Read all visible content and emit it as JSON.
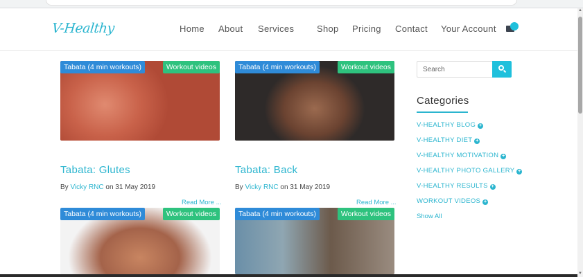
{
  "brand": {
    "logo_text": "V-Healthy"
  },
  "nav": {
    "items": [
      "Home",
      "About",
      "Services",
      "Shop",
      "Pricing",
      "Contact",
      "Your Account"
    ]
  },
  "posts": [
    {
      "category": "Tabata (4 min workouts)",
      "tag": "Workout videos",
      "title": "Tabata: Glutes",
      "by": "By",
      "author": "Vicky RNC",
      "date_prefix": "on",
      "date": "31 May 2019",
      "read_more": "Read More ..."
    },
    {
      "category": "Tabata (4 min workouts)",
      "tag": "Workout videos",
      "title": "Tabata: Back",
      "by": "By",
      "author": "Vicky RNC",
      "date_prefix": "on",
      "date": "31 May 2019",
      "read_more": "Read More ..."
    },
    {
      "category": "Tabata (4 min workouts)",
      "tag": "Workout videos"
    },
    {
      "category": "Tabata (4 min workouts)",
      "tag": "Workout videos"
    }
  ],
  "sidebar": {
    "search_placeholder": "Search",
    "categories_title": "Categories",
    "categories": [
      "V-HEALTHY BLOG",
      "V-HEALTHY DIET",
      "V-HEALTHY MOTIVATION",
      "V-HEALTHY PHOTO GALLERY",
      "V-HEALTHY RESULTS",
      "WORKOUT VIDEOS"
    ],
    "show_all": "Show All"
  },
  "colors": {
    "accent": "#2bb5cf",
    "badge_blue": "#2f8bd8",
    "badge_green": "#2ec27e",
    "search_button": "#1fc0dc"
  },
  "icons": [
    "search-icon",
    "cart-icon",
    "plus-circle-icon"
  ]
}
